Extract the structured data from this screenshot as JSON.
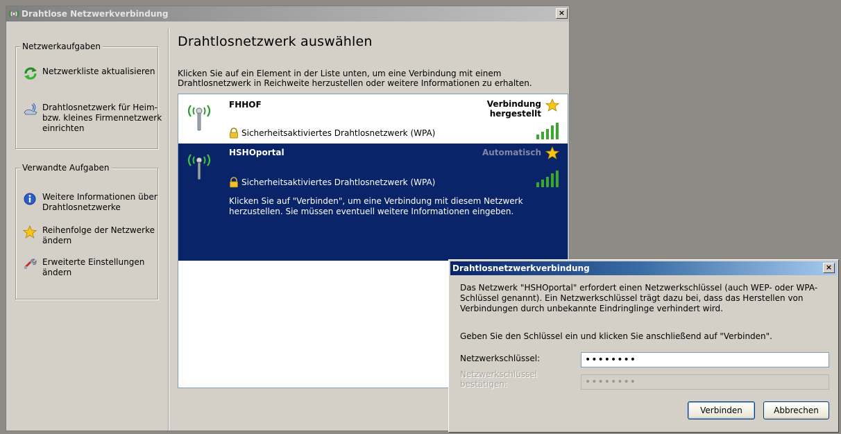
{
  "main_window": {
    "title": "Drahtlose Netzwerkverbindung",
    "close_label": "×"
  },
  "network_tasks": {
    "group_title": "Netzwerkaufgaben",
    "items": [
      {
        "label": "Netzwerkliste aktualisieren",
        "icon": "refresh-icon"
      },
      {
        "label": "Drahtlosnetzwerk für Heim- bzw. kleines Firmennetzwerk einrichten",
        "icon": "wireless-setup-icon"
      }
    ]
  },
  "related_tasks": {
    "group_title": "Verwandte Aufgaben",
    "items": [
      {
        "label": "Weitere Informationen über Drahtlosnetzwerke",
        "icon": "info-icon"
      },
      {
        "label": "Reihenfolge der Netzwerke ändern",
        "icon": "star-icon"
      },
      {
        "label": "Erweiterte Einstellungen ändern",
        "icon": "settings-icon"
      }
    ]
  },
  "content": {
    "heading": "Drahtlosnetzwerk auswählen",
    "intro": "Klicken Sie auf ein Element in der Liste unten, um eine Verbindung mit einem Drahtlosnetzwerk in Reichweite herzustellen oder weitere Informationen zu erhalten."
  },
  "networks": [
    {
      "name": "FHHOF",
      "status_line1": "Verbindung",
      "status_line2": "hergestellt",
      "security": "Sicherheitsaktiviertes Drahtlosnetzwerk (WPA)",
      "signal_bars": 5,
      "selected": false
    },
    {
      "name": "HSHOportal",
      "status_line1": "Automatisch",
      "security": "Sicherheitsaktiviertes Drahtlosnetzwerk (WPA)",
      "description": "Klicken Sie auf \"Verbinden\", um eine Verbindung mit diesem Netzwerk herzustellen. Sie müssen eventuell weitere Informationen eingeben.",
      "signal_bars": 5,
      "selected": true
    }
  ],
  "dialog": {
    "title": "Drahtlosnetzwerkverbindung",
    "close_label": "×",
    "message": "Das Netzwerk \"HSHOportal\" erfordert einen Netzwerkschlüssel (auch WEP- oder WPA-Schlüssel genannt). Ein Netzwerkschlüssel trägt dazu bei, dass das Herstellen von Verbindungen durch unbekannte Eindringlinge verhindert wird.",
    "instruction": "Geben Sie den Schlüssel ein und klicken Sie anschließend auf \"Verbinden\".",
    "key_label": "Netzwerkschlüssel:",
    "key_value": "••••••••",
    "confirm_label": "Netzwerkschlüssel bestätigen:",
    "confirm_value": "••••••••",
    "connect_label": "Verbinden",
    "cancel_label": "Abbrechen"
  },
  "colors": {
    "selection": "#0a246a",
    "dialog_title_start": "#0a246a",
    "signal_green": "#3aa82a",
    "star_gold": "#f5c518"
  }
}
